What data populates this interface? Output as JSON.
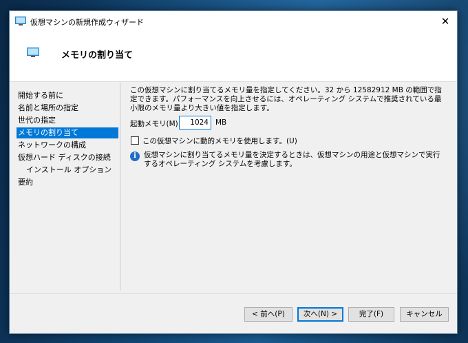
{
  "window": {
    "title": "仮想マシンの新規作成ウィザード",
    "close_glyph": "✕"
  },
  "header": {
    "title": "メモリの割り当て"
  },
  "nav": {
    "items": [
      {
        "label": "開始する前に",
        "selected": false
      },
      {
        "label": "名前と場所の指定",
        "selected": false
      },
      {
        "label": "世代の指定",
        "selected": false
      },
      {
        "label": "メモリの割り当て",
        "selected": true
      },
      {
        "label": "ネットワークの構成",
        "selected": false
      },
      {
        "label": "仮想ハード ディスクの接続",
        "selected": false
      },
      {
        "label": "インストール オプション",
        "selected": false,
        "sub": true
      },
      {
        "label": "要約",
        "selected": false
      }
    ]
  },
  "content": {
    "description": "この仮想マシンに割り当てるメモリ量を指定してください。32 から 12582912 MB の範囲で指定できます。パフォーマンスを向上させるには、オペレーティング システムで推奨されている最小限のメモリ量より大きい値を指定します。",
    "startup_memory_label": "起動メモリ(M):",
    "startup_memory_value": "1024",
    "memory_unit": "MB",
    "dynamic_memory_label": "この仮想マシンに動的メモリを使用します。(U)",
    "dynamic_memory_checked": false,
    "info_glyph": "i",
    "info_text": "仮想マシンに割り当てるメモリ量を決定するときは、仮想マシンの用途と仮想マシンで実行するオペレーティング システムを考慮します。"
  },
  "buttons": {
    "prev": "< 前へ(P)",
    "next": "次へ(N) >",
    "finish": "完了(F)",
    "cancel": "キャンセル"
  },
  "colors": {
    "accent": "#0078d7",
    "info": "#1e6ec8"
  },
  "icons": {
    "window": "monitor-icon",
    "header": "monitor-icon",
    "info": "info-icon",
    "close": "close-icon"
  }
}
